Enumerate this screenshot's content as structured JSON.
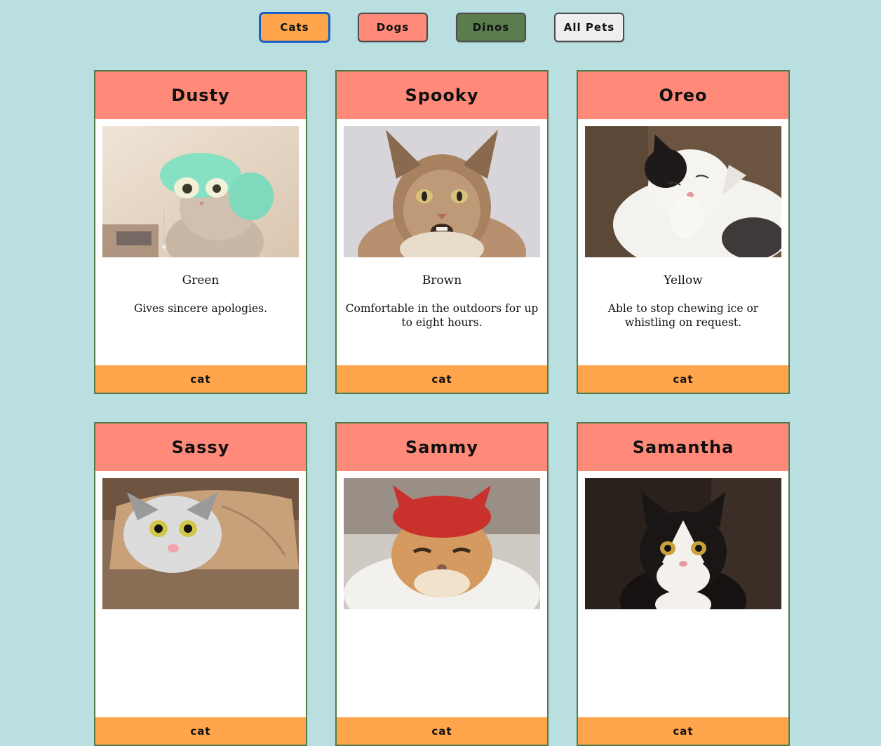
{
  "filters": {
    "cats": "Cats",
    "dogs": "Dogs",
    "dinos": "Dinos",
    "all": "All Pets",
    "active": "Cats"
  },
  "pets": [
    {
      "name": "Dusty",
      "color": "Green",
      "description": "Gives sincere apologies.",
      "type": "cat",
      "photo": "cat-in-green-towel-photo"
    },
    {
      "name": "Spooky",
      "color": "Brown",
      "description": "Comfortable in the outdoors for up to eight hours.",
      "type": "cat",
      "photo": "maine-coon-cat-photo"
    },
    {
      "name": "Oreo",
      "color": "Yellow",
      "description": "Able to stop chewing ice or whistling on request.",
      "type": "cat",
      "photo": "black-white-cat-photo"
    },
    {
      "name": "Sassy",
      "type": "cat",
      "photo": "cat-in-paper-roll-photo"
    },
    {
      "name": "Sammy",
      "type": "cat",
      "photo": "cat-in-red-hat-photo"
    },
    {
      "name": "Samantha",
      "type": "cat",
      "photo": "tuxedo-cat-photo"
    }
  ],
  "colors": {
    "background": "#b9dfe0",
    "card_header": "#ff8a7a",
    "card_footer": "#ffa64d",
    "card_border": "#4e7a4b",
    "cats_button": "#ffa64d",
    "dogs_button": "#ff8a7a",
    "dinos_button": "#5b7d4e",
    "all_button": "#eeeeee"
  }
}
